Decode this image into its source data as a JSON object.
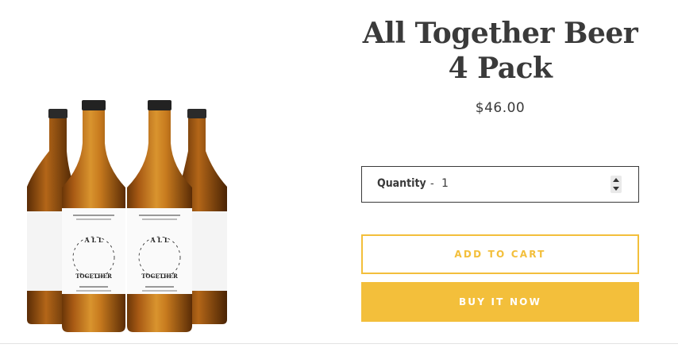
{
  "product": {
    "title_line1": "All Together Beer",
    "title_line2": "4 Pack",
    "price": "$46.00"
  },
  "quantity": {
    "label": "Quantity",
    "separator": "-",
    "value": "1"
  },
  "buttons": {
    "add_to_cart": "ADD TO CART",
    "buy_now": "BUY IT NOW"
  },
  "bottle_label": {
    "circle_text": "ALL TOGETHER",
    "top_line1": "A WORLDWIDE COLLABORATION BEHIND",
    "top_line2": "PROFESSIONALS",
    "bottom_line1": "NEW PALE ALE",
    "bottom_line2": "6.0% ALC/VOL | 355ML"
  },
  "colors": {
    "accent": "#f3bf3b",
    "text": "#3a3a3a",
    "amber": "#b8671c"
  },
  "icons": {
    "spinner": "up-down-arrows"
  }
}
